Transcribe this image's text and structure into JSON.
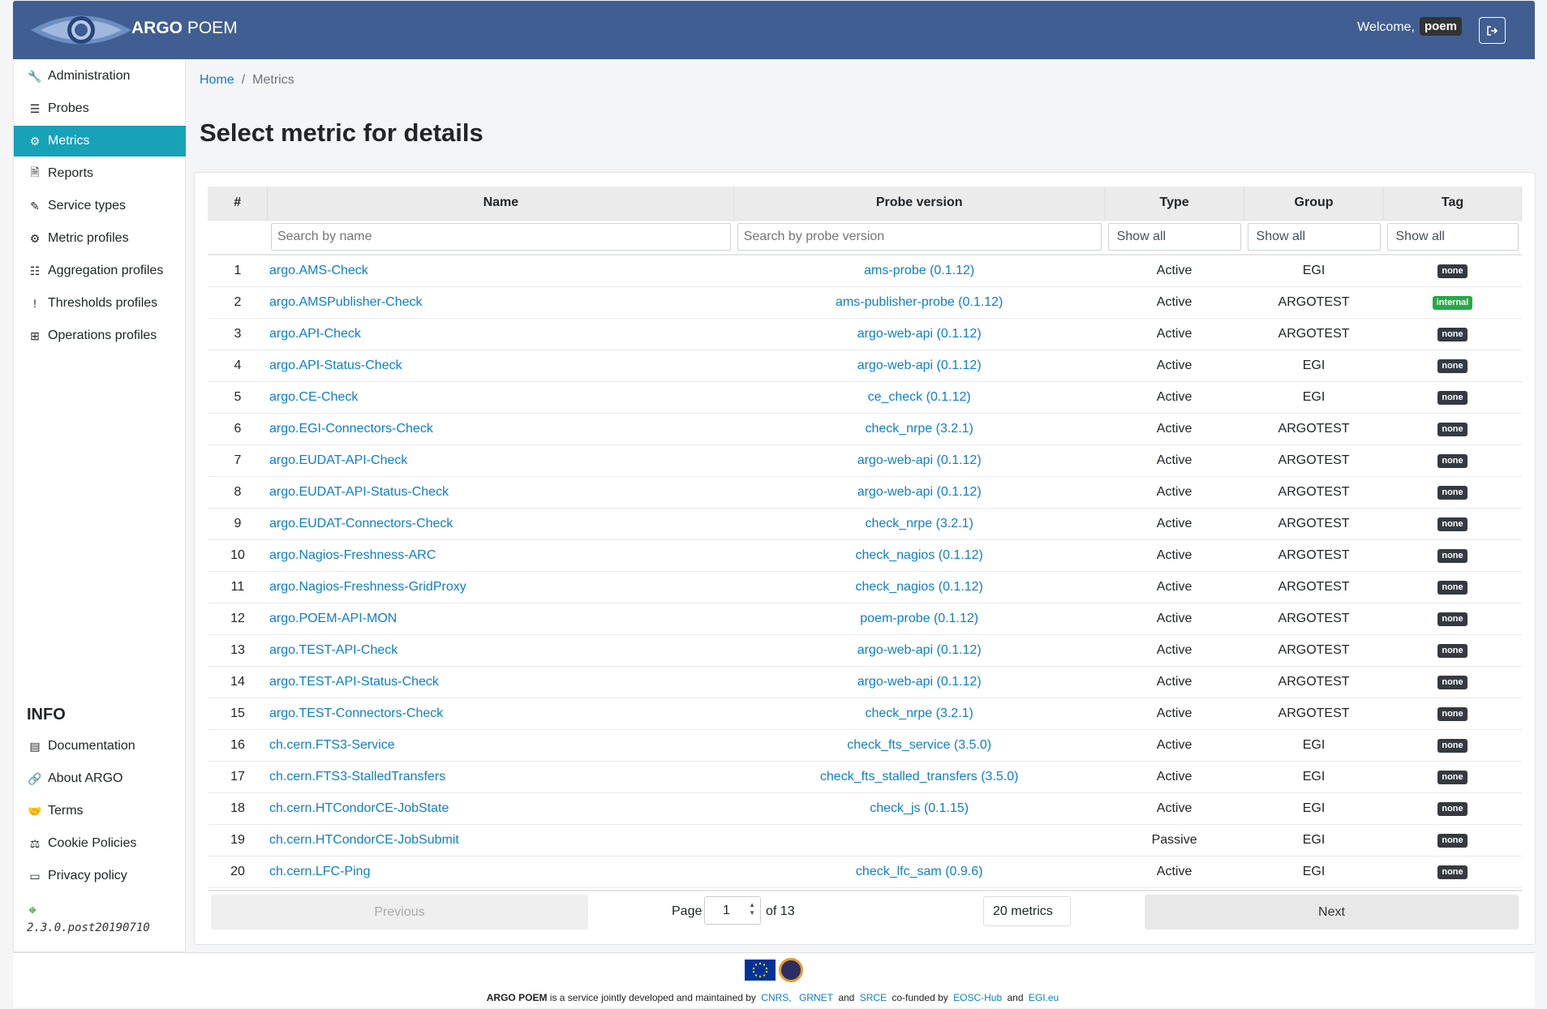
{
  "header": {
    "app_name_bold": "ARGO",
    "app_name_rest": "POEM",
    "welcome": "Welcome,",
    "username": "poem"
  },
  "sidebar": {
    "items": [
      {
        "label": "Administration",
        "icon": "wrench-icon",
        "glyph": "🔧"
      },
      {
        "label": "Probes",
        "icon": "server-icon",
        "glyph": "☰"
      },
      {
        "label": "Metrics",
        "icon": "cog-icon",
        "glyph": "⚙"
      },
      {
        "label": "Reports",
        "icon": "file-icon",
        "glyph": "🗎"
      },
      {
        "label": "Service types",
        "icon": "pencil-icon",
        "glyph": "✎"
      },
      {
        "label": "Metric profiles",
        "icon": "cogs-icon",
        "glyph": "⚙"
      },
      {
        "label": "Aggregation profiles",
        "icon": "tasks-icon",
        "glyph": "☷"
      },
      {
        "label": "Thresholds profiles",
        "icon": "exclamation-icon",
        "glyph": "!"
      },
      {
        "label": "Operations profiles",
        "icon": "table-icon",
        "glyph": "⊞"
      }
    ],
    "active_index": 2,
    "info_title": "INFO",
    "info_items": [
      {
        "label": "Documentation",
        "icon": "book-icon",
        "glyph": "▤"
      },
      {
        "label": "About ARGO",
        "icon": "link-icon",
        "glyph": "🔗"
      },
      {
        "label": "Terms",
        "icon": "handshake-icon",
        "glyph": "🤝"
      },
      {
        "label": "Cookie Policies",
        "icon": "gavel-icon",
        "glyph": "⚖"
      },
      {
        "label": "Privacy policy",
        "icon": "id-card-icon",
        "glyph": "▭"
      }
    ],
    "version": "2.3.0.post20190710"
  },
  "breadcrumb": {
    "home": "Home",
    "current": "Metrics"
  },
  "page_title": "Select metric for details",
  "table": {
    "columns": [
      "#",
      "Name",
      "Probe version",
      "Type",
      "Group",
      "Tag"
    ],
    "filters": {
      "name_placeholder": "Search by name",
      "probe_placeholder": "Search by probe version",
      "type": "Show all",
      "group": "Show all",
      "tag": "Show all"
    },
    "rows": [
      {
        "num": "1",
        "name": "argo.AMS-Check",
        "probe": "ams-probe (0.1.12)",
        "type": "Active",
        "group": "EGI",
        "tag": "none"
      },
      {
        "num": "2",
        "name": "argo.AMSPublisher-Check",
        "probe": "ams-publisher-probe (0.1.12)",
        "type": "Active",
        "group": "ARGOTEST",
        "tag": "internal"
      },
      {
        "num": "3",
        "name": "argo.API-Check",
        "probe": "argo-web-api (0.1.12)",
        "type": "Active",
        "group": "ARGOTEST",
        "tag": "none"
      },
      {
        "num": "4",
        "name": "argo.API-Status-Check",
        "probe": "argo-web-api (0.1.12)",
        "type": "Active",
        "group": "EGI",
        "tag": "none"
      },
      {
        "num": "5",
        "name": "argo.CE-Check",
        "probe": "ce_check (0.1.12)",
        "type": "Active",
        "group": "EGI",
        "tag": "none"
      },
      {
        "num": "6",
        "name": "argo.EGI-Connectors-Check",
        "probe": "check_nrpe (3.2.1)",
        "type": "Active",
        "group": "ARGOTEST",
        "tag": "none"
      },
      {
        "num": "7",
        "name": "argo.EUDAT-API-Check",
        "probe": "argo-web-api (0.1.12)",
        "type": "Active",
        "group": "ARGOTEST",
        "tag": "none"
      },
      {
        "num": "8",
        "name": "argo.EUDAT-API-Status-Check",
        "probe": "argo-web-api (0.1.12)",
        "type": "Active",
        "group": "ARGOTEST",
        "tag": "none"
      },
      {
        "num": "9",
        "name": "argo.EUDAT-Connectors-Check",
        "probe": "check_nrpe (3.2.1)",
        "type": "Active",
        "group": "ARGOTEST",
        "tag": "none"
      },
      {
        "num": "10",
        "name": "argo.Nagios-Freshness-ARC",
        "probe": "check_nagios (0.1.12)",
        "type": "Active",
        "group": "ARGOTEST",
        "tag": "none"
      },
      {
        "num": "11",
        "name": "argo.Nagios-Freshness-GridProxy",
        "probe": "check_nagios (0.1.12)",
        "type": "Active",
        "group": "ARGOTEST",
        "tag": "none"
      },
      {
        "num": "12",
        "name": "argo.POEM-API-MON",
        "probe": "poem-probe (0.1.12)",
        "type": "Active",
        "group": "ARGOTEST",
        "tag": "none"
      },
      {
        "num": "13",
        "name": "argo.TEST-API-Check",
        "probe": "argo-web-api (0.1.12)",
        "type": "Active",
        "group": "ARGOTEST",
        "tag": "none"
      },
      {
        "num": "14",
        "name": "argo.TEST-API-Status-Check",
        "probe": "argo-web-api (0.1.12)",
        "type": "Active",
        "group": "ARGOTEST",
        "tag": "none"
      },
      {
        "num": "15",
        "name": "argo.TEST-Connectors-Check",
        "probe": "check_nrpe (3.2.1)",
        "type": "Active",
        "group": "ARGOTEST",
        "tag": "none"
      },
      {
        "num": "16",
        "name": "ch.cern.FTS3-Service",
        "probe": "check_fts_service (3.5.0)",
        "type": "Active",
        "group": "EGI",
        "tag": "none"
      },
      {
        "num": "17",
        "name": "ch.cern.FTS3-StalledTransfers",
        "probe": "check_fts_stalled_transfers (3.5.0)",
        "type": "Active",
        "group": "EGI",
        "tag": "none"
      },
      {
        "num": "18",
        "name": "ch.cern.HTCondorCE-JobState",
        "probe": "check_js (0.1.15)",
        "type": "Active",
        "group": "EGI",
        "tag": "none"
      },
      {
        "num": "19",
        "name": "ch.cern.HTCondorCE-JobSubmit",
        "probe": "",
        "type": "Passive",
        "group": "EGI",
        "tag": "none"
      },
      {
        "num": "20",
        "name": "ch.cern.LFC-Ping",
        "probe": "check_lfc_sam (0.9.6)",
        "type": "Active",
        "group": "EGI",
        "tag": "none"
      }
    ]
  },
  "pagination": {
    "previous": "Previous",
    "next": "Next",
    "page_label": "Page",
    "page_value": "1",
    "of_label": "of 13",
    "per_page": "20 metrics"
  },
  "footer": {
    "brand": "ARGO POEM",
    "text1": "is a service jointly developed and maintained by",
    "cnrs": "CNRS,",
    "grnet": "GRNET",
    "and1": "and",
    "srce": "SRCE",
    "text2": "co-funded by",
    "eosc": "EOSC-Hub",
    "and2": "and",
    "egi": "EGI.eu"
  },
  "colors": {
    "header_bg": "#405e91",
    "active_sidebar": "#17a2b8",
    "link": "#0d7ecf",
    "tag_none": "#343a40",
    "tag_internal": "#28a745"
  }
}
